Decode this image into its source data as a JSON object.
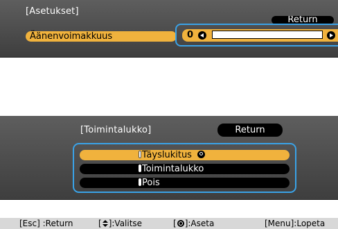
{
  "top_panel": {
    "title": "[Asetukset]",
    "return_label": "Return",
    "setting_label": "Äänenvoimakkuus",
    "volume_value": "0",
    "volume_fraction": 0.0
  },
  "lock_panel": {
    "title": "[Toimintalukko]",
    "return_label": "Return",
    "options": [
      {
        "label": "Täyslukitus",
        "selected": true
      },
      {
        "label": "Toimintalukko",
        "selected": false
      },
      {
        "label": "Pois",
        "selected": false
      }
    ]
  },
  "help_bar": {
    "esc": "[Esc] :Return",
    "select_pre": "[",
    "select_post": "]:Valitse",
    "set_pre": "[",
    "set_post": "]:Aseta",
    "menu": "[Menu]:Lopeta"
  },
  "colors": {
    "highlight": "#f0b23d",
    "outline": "#3aa3e8",
    "panel": "#4e4e4e"
  }
}
